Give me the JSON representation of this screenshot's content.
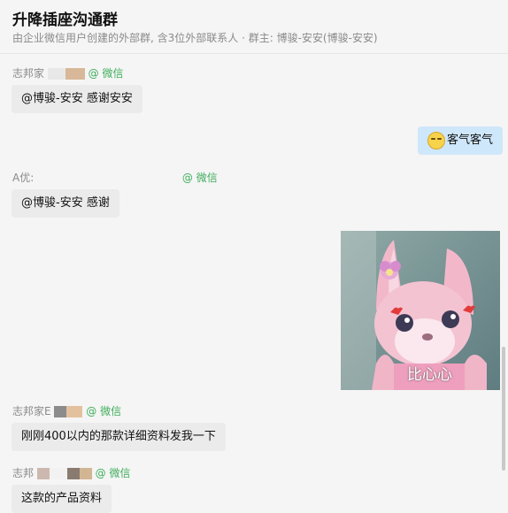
{
  "header": {
    "title": "升降插座沟通群",
    "subtitle": "由企业微信用户创建的外部群, 含3位外部联系人 · 群主: 博骏-安安(博骏-安安)"
  },
  "messages": [
    {
      "sender": "志邦家",
      "source": "@ 微信",
      "text": "@博骏-安安 感谢安安"
    },
    {
      "text": "客气客气"
    },
    {
      "sender": "A优:",
      "source": "@ 微信",
      "text": "@博骏-安安 感谢"
    },
    {
      "sticker_caption": "比心心"
    },
    {
      "sender": "志邦家E",
      "source": "@ 微信",
      "text": "刚刚400以内的那款详细资料发我一下"
    },
    {
      "sender": "志邦",
      "source": "@ 微信",
      "text": "这款的产品资料"
    }
  ]
}
